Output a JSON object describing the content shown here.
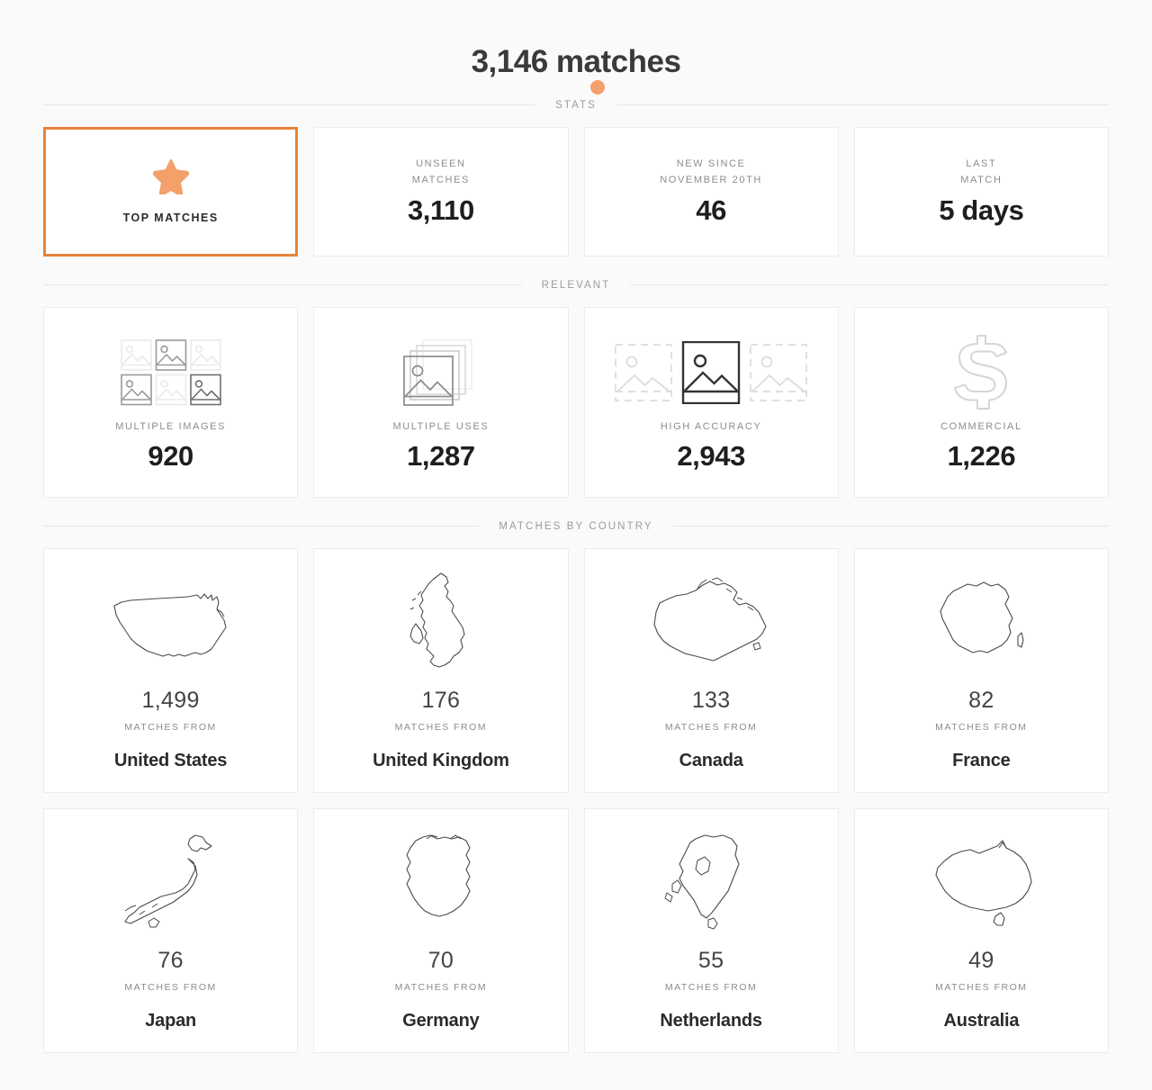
{
  "header": {
    "title": "3,146 matches"
  },
  "sections": {
    "stats_label": "STATS",
    "relevant_label": "RELEVANT",
    "country_label": "MATCHES BY COUNTRY"
  },
  "colors": {
    "accent_border": "#E8833A",
    "accent_star": "#F3A06A",
    "accent_dot": "#F3A06A",
    "page_background": "#FAFAFA",
    "card_background": "#FFFFFF",
    "card_border": "#ECECEC"
  },
  "stats": [
    {
      "icon": "star-icon",
      "label": "TOP MATCHES",
      "value": "",
      "highlighted": true
    },
    {
      "label_line1": "UNSEEN",
      "label_line2": "MATCHES",
      "value": "3,110",
      "highlighted": false
    },
    {
      "label_line1": "NEW SINCE",
      "label_line2": "NOVEMBER 20TH",
      "value": "46",
      "highlighted": false
    },
    {
      "label_line1": "LAST",
      "label_line2": "MATCH",
      "value": "5 days",
      "highlighted": false
    }
  ],
  "relevant": [
    {
      "icon": "image-grid-icon",
      "label": "MULTIPLE IMAGES",
      "value": "920"
    },
    {
      "icon": "stacked-images-icon",
      "label": "MULTIPLE USES",
      "value": "1,287"
    },
    {
      "icon": "accuracy-icon",
      "label": "HIGH ACCURACY",
      "value": "2,943"
    },
    {
      "icon": "dollar-icon",
      "label": "COMMERCIAL",
      "value": "1,226"
    }
  ],
  "countries": {
    "sub_label": "MATCHES FROM",
    "items": [
      {
        "map": "map-united-states",
        "count": "1,499",
        "name": "United States"
      },
      {
        "map": "map-united-kingdom",
        "count": "176",
        "name": "United Kingdom"
      },
      {
        "map": "map-canada",
        "count": "133",
        "name": "Canada"
      },
      {
        "map": "map-france",
        "count": "82",
        "name": "France"
      },
      {
        "map": "map-japan",
        "count": "76",
        "name": "Japan"
      },
      {
        "map": "map-germany",
        "count": "70",
        "name": "Germany"
      },
      {
        "map": "map-netherlands",
        "count": "55",
        "name": "Netherlands"
      },
      {
        "map": "map-australia",
        "count": "49",
        "name": "Australia"
      }
    ]
  }
}
